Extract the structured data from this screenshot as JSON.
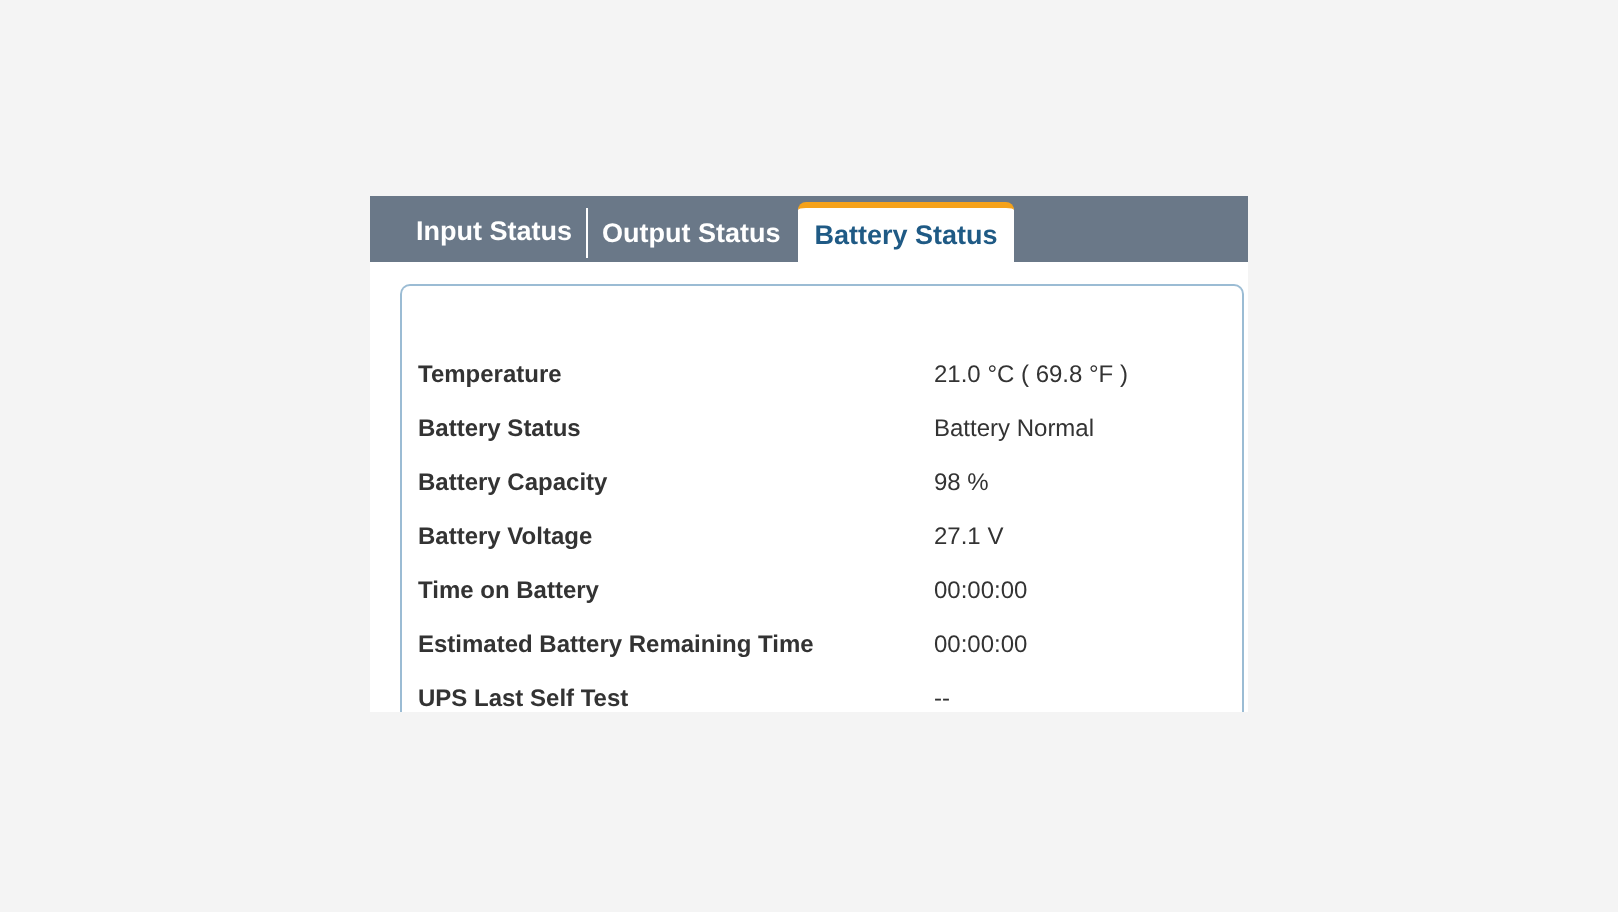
{
  "tabs": [
    {
      "label": "Input Status",
      "selected": false
    },
    {
      "label": "Output Status",
      "selected": false
    },
    {
      "label": "Battery Status",
      "selected": true
    }
  ],
  "rows": [
    {
      "label": "Temperature",
      "value": "21.0 °C ( 69.8 °F )"
    },
    {
      "label": "Battery Status",
      "value": "Battery Normal"
    },
    {
      "label": "Battery Capacity",
      "value": "98 %"
    },
    {
      "label": "Battery Voltage",
      "value": "27.1 V"
    },
    {
      "label": "Time on Battery",
      "value": "00:00:00"
    },
    {
      "label": "Estimated Battery Remaining Time",
      "value": "00:00:00"
    },
    {
      "label": "UPS Last Self Test",
      "value": "--"
    }
  ]
}
